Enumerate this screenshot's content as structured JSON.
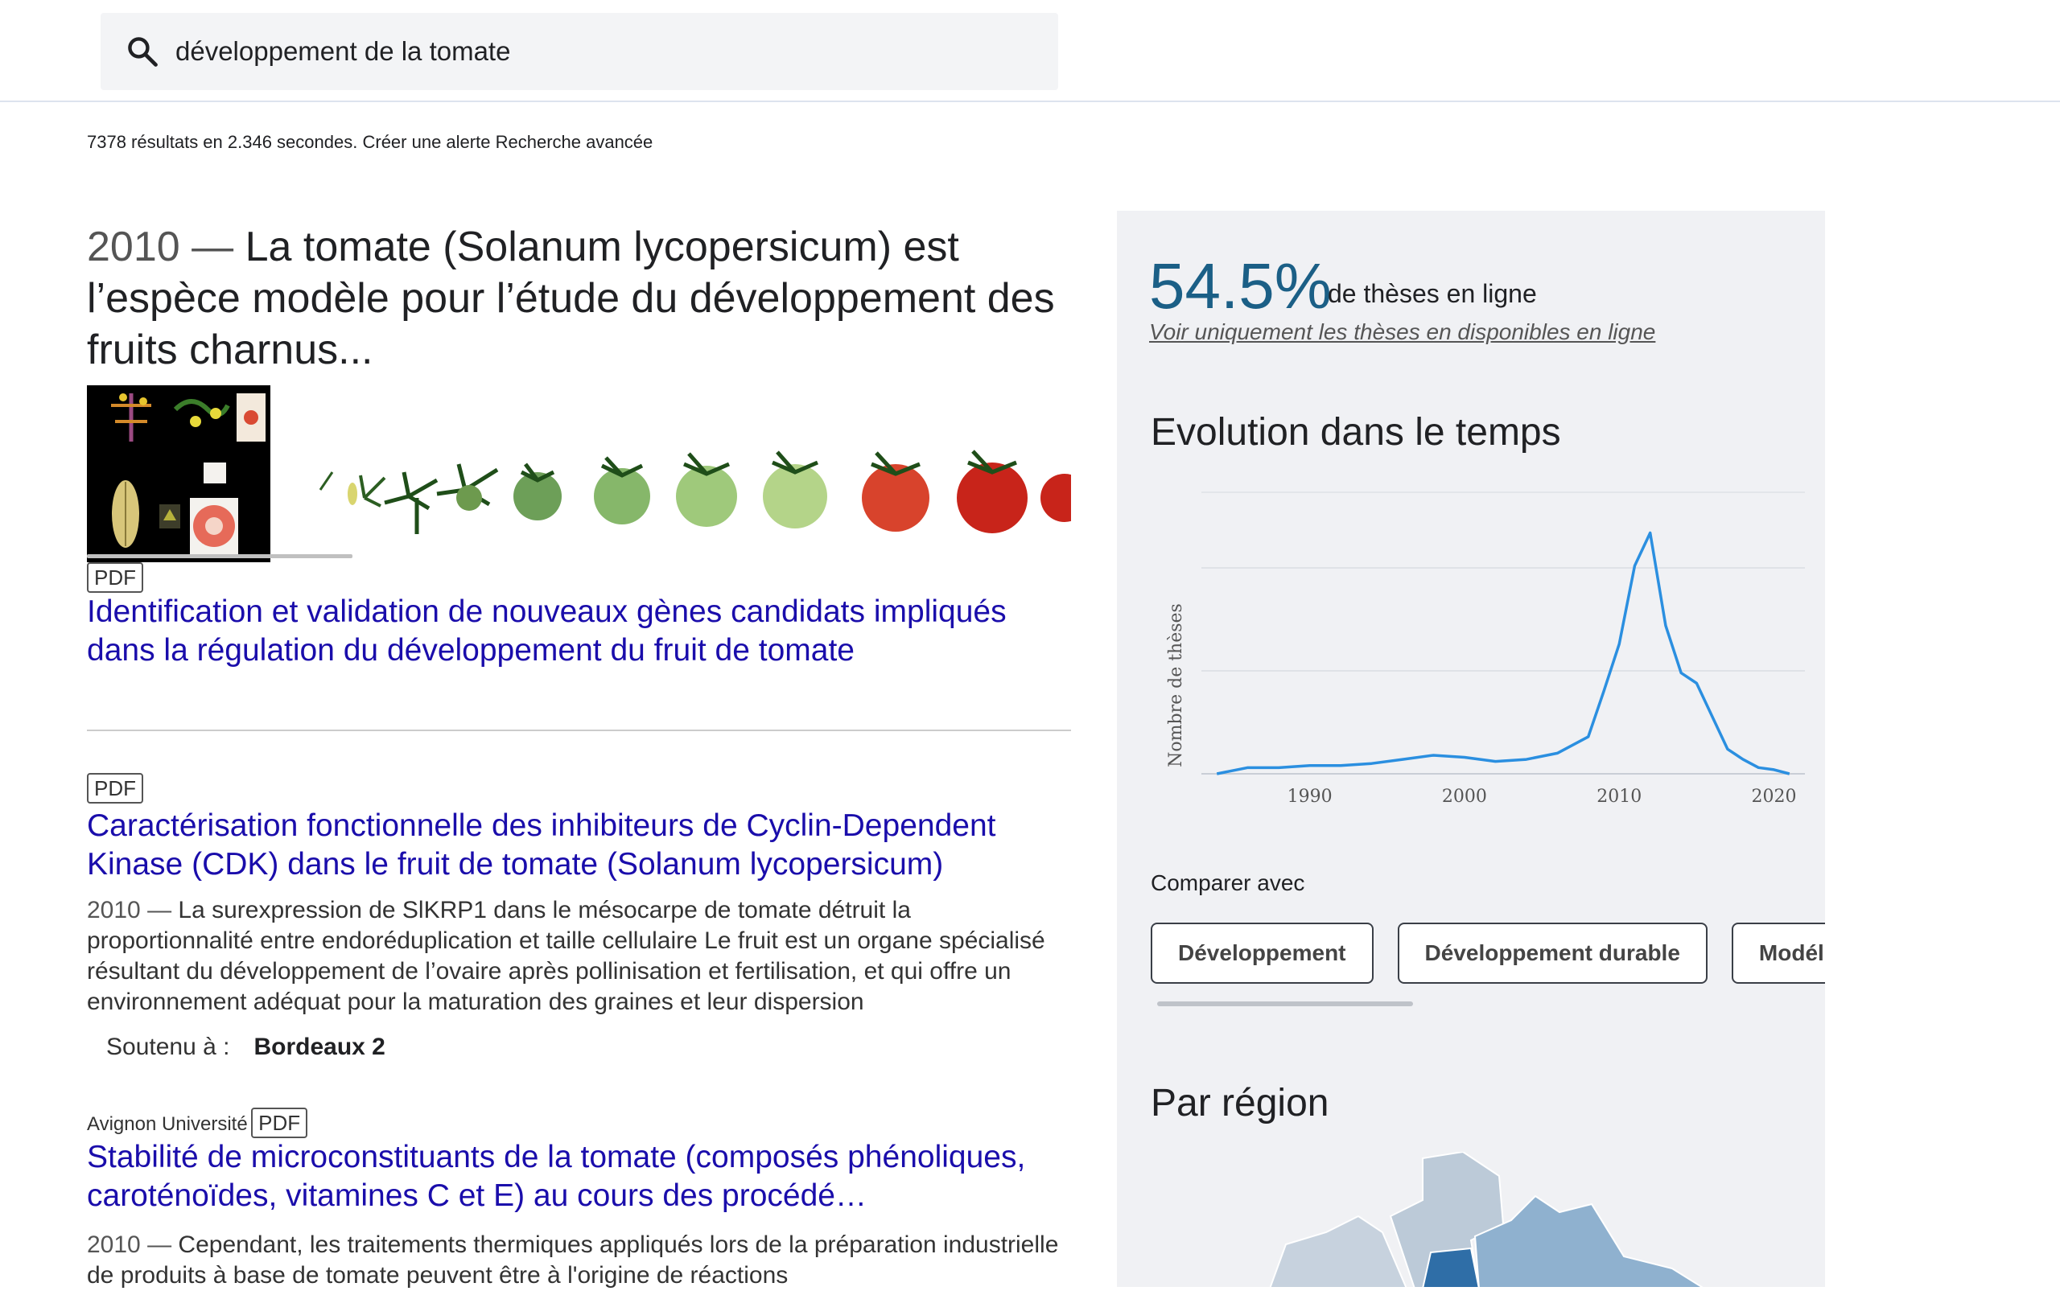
{
  "search": {
    "query": "développement de la tomate"
  },
  "stats": {
    "summary": "7378 résultats en 2.346 secondes.",
    "alert_link": "Créer une alerte",
    "advanced_link": "Recherche avancée"
  },
  "featured": {
    "year": "2010",
    "sep": " — ",
    "text": "La tomate (Solanum lycopersicum) est l’espèce modèle pour l’étude du développement des fruits charnus...",
    "badge": "PDF",
    "title": "Identification et validation de nouveaux gènes candidats impliqués dans la régulation du développement du fruit de tomate"
  },
  "results": [
    {
      "badge": "PDF",
      "title": "Caractérisation fonctionnelle des inhibiteurs de Cyclin-Dependent Kinase (CDK) dans le fruit de tomate (Solanum lycopersicum)",
      "year": "2010",
      "sep": " — ",
      "snippet": "La surexpression de SlKRP1 dans le mésocarpe de tomate détruit la proportionnalité entre endoréduplication et taille cellulaire Le fruit est un organe spécialisé résultant du développement de l’ovaire après pollinisation et fertilisation, et qui offre un environnement adéquat pour la maturation des graines et leur dispersion",
      "soutenu_label": "Soutenu à :",
      "soutenu_value": "Bordeaux 2"
    },
    {
      "university": "Avignon Université",
      "badge": "PDF",
      "title": "Stabilité de microconstituants de la tomate (composés phénoliques, caroténoïdes, vitamines C et E) au cours des procédé…",
      "year": "2010",
      "sep": " — ",
      "snippet": "Cependant, les traitements thermiques appliqués lors de la préparation industrielle de produits à base de tomate peuvent être à l'origine de réactions"
    }
  ],
  "panel": {
    "percent": "54.5%",
    "percent_label": "de thèses en ligne",
    "online_link": "Voir uniquement les thèses en disponibles en ligne",
    "evolution_title": "Evolution dans le temps",
    "compare_label": "Comparer avec",
    "chips": [
      "Développement",
      "Développement durable",
      "Modélisation"
    ],
    "region_title": "Par région"
  },
  "colors": {
    "link": "#1a0dab",
    "accent": "#1b5f86",
    "line": "#2b8fe0",
    "panel_bg": "#f0f1f4"
  },
  "chart_data": {
    "type": "line",
    "title": "Evolution dans le temps",
    "xlabel": "",
    "ylabel": "Nombre de thèses",
    "x": [
      1984,
      1986,
      1988,
      1990,
      1992,
      1994,
      1996,
      1998,
      2000,
      2002,
      2004,
      2006,
      2008,
      2009,
      2010,
      2011,
      2012,
      2013,
      2014,
      2015,
      2016,
      2017,
      2018,
      2019,
      2020,
      2021
    ],
    "series": [
      {
        "values": [
          0,
          3,
          3,
          4,
          4,
          5,
          7,
          9,
          8,
          6,
          7,
          10,
          18,
          40,
          63,
          101,
          117,
          72,
          49,
          44,
          28,
          12,
          7,
          3,
          2,
          0
        ]
      }
    ],
    "xticks": [
      1990,
      2000,
      2010,
      2020
    ],
    "xlim": [
      1983,
      2022
    ],
    "ylim": [
      0,
      125
    ],
    "grid": true,
    "legend": "none"
  }
}
